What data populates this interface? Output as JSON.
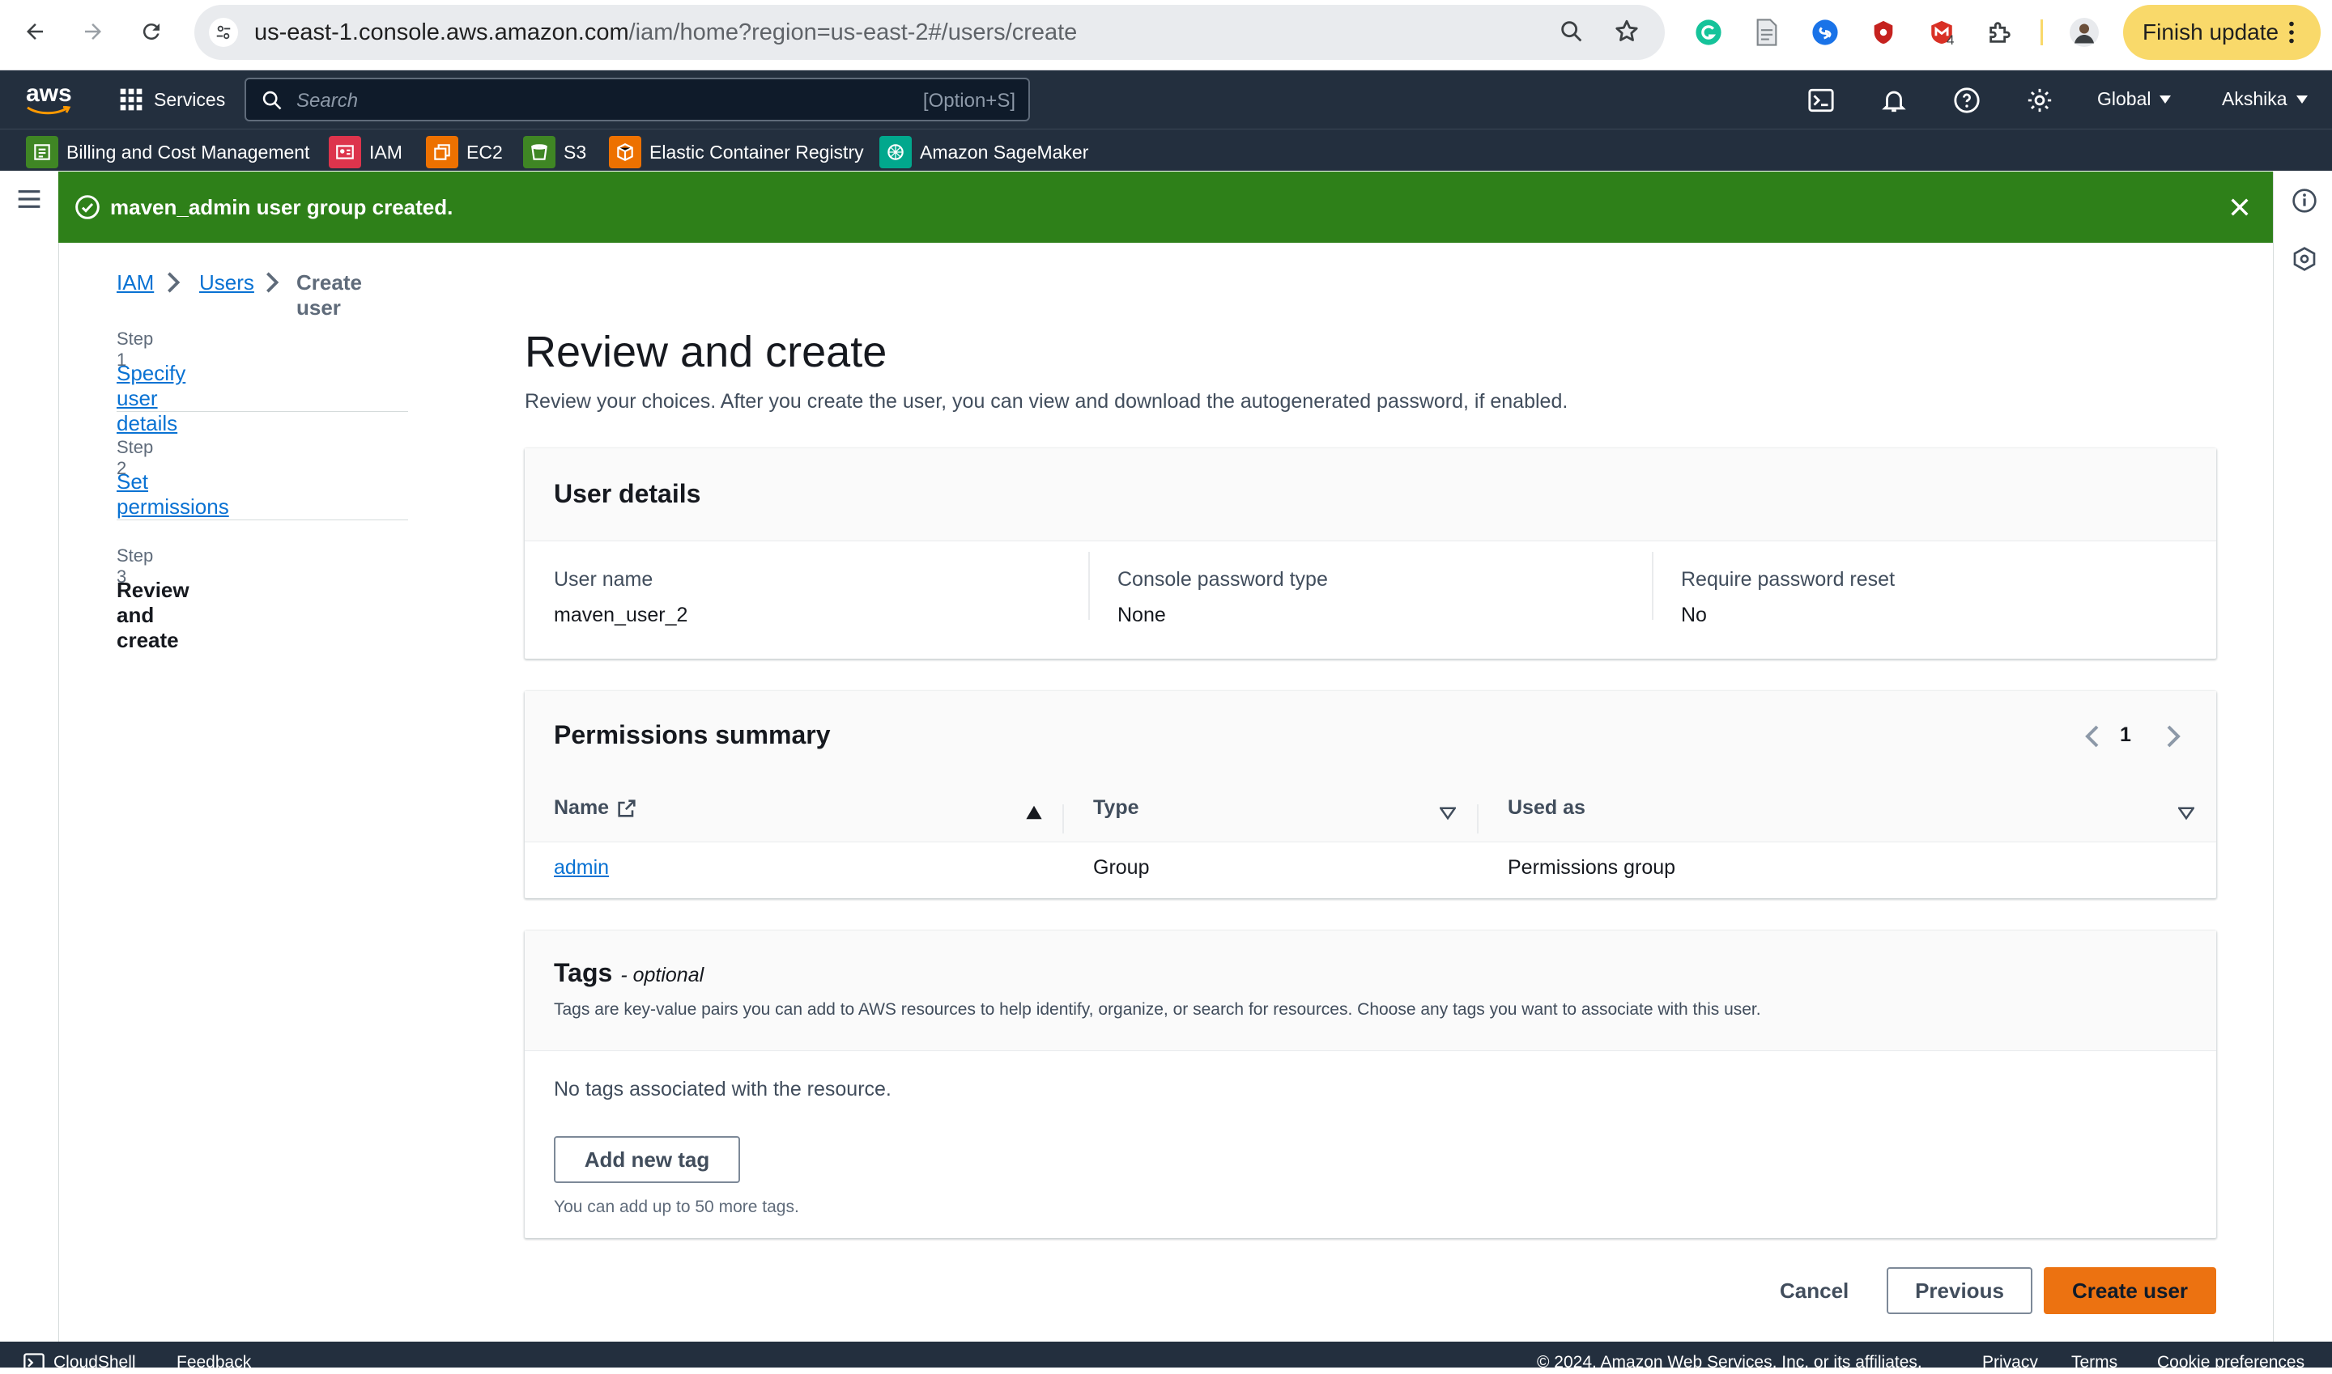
{
  "browser": {
    "url_host": "us-east-1.console.aws.amazon.com",
    "url_path": "/iam/home?region=us-east-2#/users/create",
    "extension_badge": "4",
    "finish_update_label": "Finish update"
  },
  "aws_nav": {
    "logo": "aws",
    "services_label": "Services",
    "search_placeholder": "Search",
    "search_shortcut": "[Option+S]",
    "region_label": "Global",
    "account_label": "Akshika",
    "favorites": [
      {
        "label": "Billing and Cost Management",
        "icon": "billing-icon",
        "color": "#3f8624"
      },
      {
        "label": "IAM",
        "icon": "iam-icon",
        "color": "#dd344c"
      },
      {
        "label": "EC2",
        "icon": "ec2-icon",
        "color": "#ed7100"
      },
      {
        "label": "S3",
        "icon": "s3-icon",
        "color": "#3f8624"
      },
      {
        "label": "Elastic Container Registry",
        "icon": "ecr-icon",
        "color": "#ed7100"
      },
      {
        "label": "Amazon SageMaker",
        "icon": "sagemaker-icon",
        "color": "#01a88d"
      }
    ]
  },
  "flash": {
    "message": "maven_admin user group created.",
    "color": "#2e8019"
  },
  "breadcrumb": {
    "items": [
      "IAM",
      "Users"
    ],
    "current": "Create user"
  },
  "wizard": {
    "steps": [
      {
        "step": "Step 1",
        "label": "Specify user details"
      },
      {
        "step": "Step 2",
        "label": "Set permissions"
      },
      {
        "step": "Step 3",
        "label": "Review and create"
      }
    ]
  },
  "main": {
    "title": "Review and create",
    "description": "Review your choices. After you create the user, you can view and download the autogenerated password, if enabled."
  },
  "user_details": {
    "heading": "User details",
    "fields": [
      {
        "label": "User name",
        "value": "maven_user_2"
      },
      {
        "label": "Console password type",
        "value": "None"
      },
      {
        "label": "Require password reset",
        "value": "No"
      }
    ]
  },
  "permissions": {
    "heading": "Permissions summary",
    "page": "1",
    "columns": [
      "Name",
      "Type",
      "Used as"
    ],
    "rows": [
      {
        "name": "admin",
        "type": "Group",
        "used_as": "Permissions group"
      }
    ]
  },
  "tags": {
    "heading": "Tags",
    "heading_suffix": "- optional",
    "description": "Tags are key-value pairs you can add to AWS resources to help identify, organize, or search for resources. Choose any tags you want to associate with this user.",
    "empty_text": "No tags associated with the resource.",
    "add_button": "Add new tag",
    "limit_text": "You can add up to 50 more tags."
  },
  "actions": {
    "cancel": "Cancel",
    "previous": "Previous",
    "create": "Create user",
    "primary_color": "#ec7211"
  },
  "footer": {
    "cloudshell": "CloudShell",
    "feedback": "Feedback",
    "copyright": "© 2024, Amazon Web Services, Inc. or its affiliates.",
    "privacy": "Privacy",
    "terms": "Terms",
    "cookies": "Cookie preferences"
  }
}
